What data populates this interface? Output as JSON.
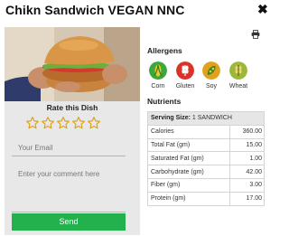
{
  "header": {
    "title": "Chikn Sandwich VEGAN NNC",
    "close_label": "✖"
  },
  "image": {
    "alt": "Chikn Sandwich"
  },
  "rating": {
    "title": "Rate this Dish",
    "stars": 5,
    "email_placeholder": "Your Email",
    "comment_placeholder": "Enter your comment here",
    "send_label": "Send",
    "send_color": "#22b14c"
  },
  "allergens": {
    "title": "Allergens",
    "items": [
      {
        "label": "Corn",
        "icon": "corn-icon",
        "color": "#3aa83a"
      },
      {
        "label": "Gluten",
        "icon": "gluten-icon",
        "color": "#d9342b"
      },
      {
        "label": "Soy",
        "icon": "soy-icon",
        "color": "#e0a21c"
      },
      {
        "label": "Wheat",
        "icon": "wheat-icon",
        "color": "#9cb83a"
      }
    ]
  },
  "nutrients": {
    "title": "Nutrients",
    "serving_label": "Serving Size:",
    "serving_value": "1 SANDWICH",
    "rows": [
      {
        "label": "Calories",
        "value": "360.00"
      },
      {
        "label": "Total Fat (gm)",
        "value": "15.00"
      },
      {
        "label": "Saturated Fat (gm)",
        "value": "1.00"
      },
      {
        "label": "Carbohydrate (gm)",
        "value": "42.00"
      },
      {
        "label": "Fiber (gm)",
        "value": "3.00"
      },
      {
        "label": "Protein (gm)",
        "value": "17.00"
      }
    ]
  }
}
